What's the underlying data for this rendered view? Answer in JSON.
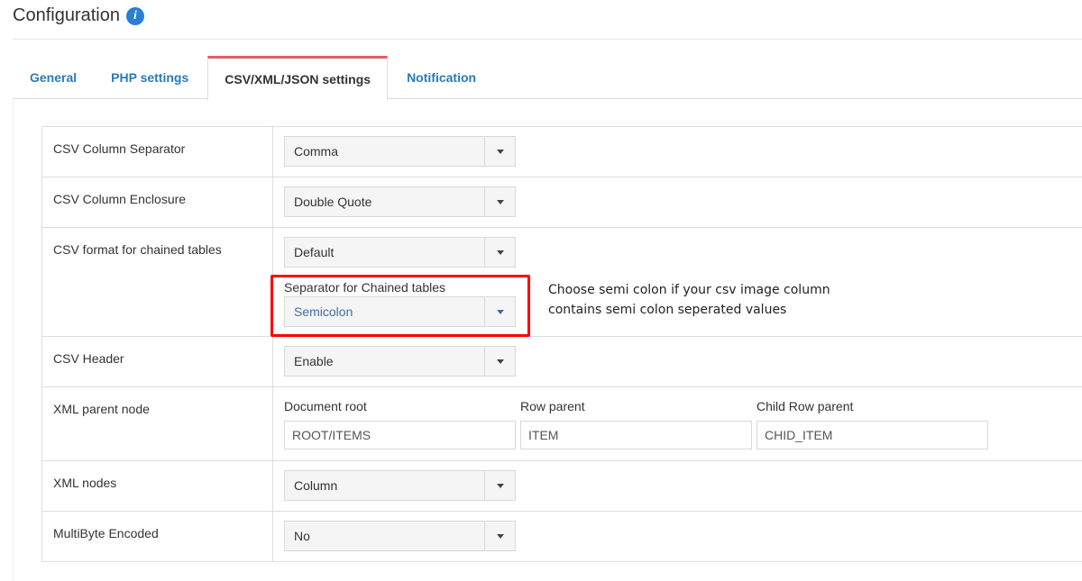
{
  "header": {
    "title": "Configuration",
    "info_icon": "i"
  },
  "tabs": [
    {
      "label": "General",
      "active": false
    },
    {
      "label": "PHP settings",
      "active": false
    },
    {
      "label": "CSV/XML/JSON settings",
      "active": true
    },
    {
      "label": "Notification",
      "active": false
    }
  ],
  "colors": {
    "accent": "#e55c66",
    "link": "#2a7ab8",
    "highlight_box": "#ff0000",
    "info": "#2a7fd4"
  },
  "settings": {
    "csv_column_separator": {
      "label": "CSV Column Separator",
      "value": "Comma"
    },
    "csv_column_enclosure": {
      "label": "CSV Column Enclosure",
      "value": "Double Quote"
    },
    "csv_chained_format": {
      "label": "CSV format for chained tables",
      "value": "Default",
      "separator_label": "Separator for Chained tables",
      "separator_value": "Semicolon",
      "annotation": "Choose semi colon if your csv image column contains semi colon seperated values"
    },
    "csv_header": {
      "label": "CSV Header",
      "value": "Enable"
    },
    "xml_parent_node": {
      "label": "XML parent node",
      "document_root_label": "Document root",
      "document_root_value": "ROOT/ITEMS",
      "row_parent_label": "Row parent",
      "row_parent_value": "ITEM",
      "child_row_parent_label": "Child Row parent",
      "child_row_parent_value": "CHID_ITEM"
    },
    "xml_nodes": {
      "label": "XML nodes",
      "value": "Column"
    },
    "multibyte_encoded": {
      "label": "MultiByte Encoded",
      "value": "No"
    }
  }
}
